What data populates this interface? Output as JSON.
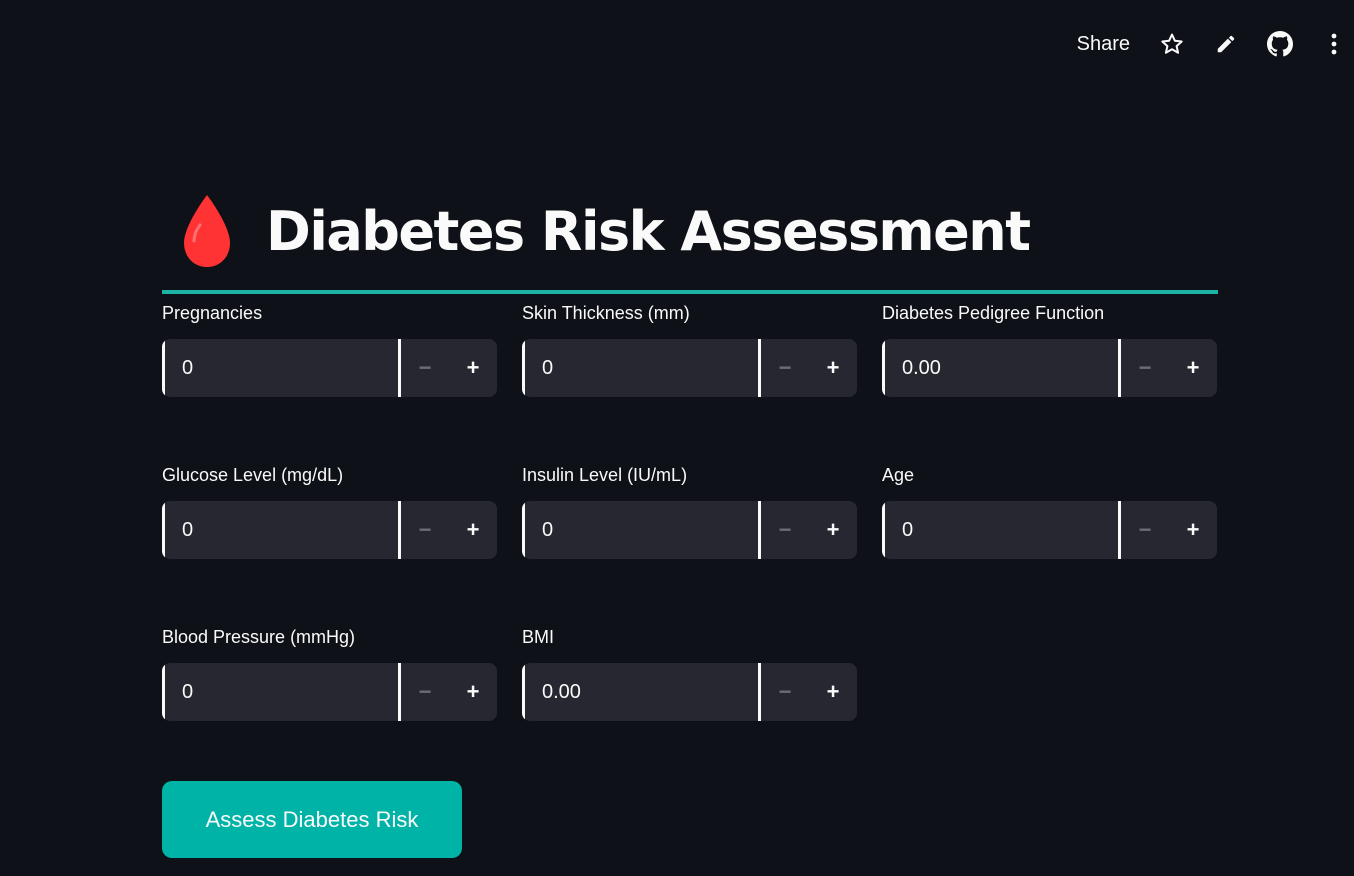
{
  "toolbar": {
    "share_label": "Share",
    "icons": [
      "star-icon",
      "pencil-icon",
      "github-icon",
      "more-vertical-icon"
    ]
  },
  "header": {
    "icon": "blood-drop-icon",
    "icon_color": "#ff3333",
    "title": "Diabetes Risk Assessment",
    "divider_color": "#1db3a5"
  },
  "form": {
    "pregnancies": {
      "label": "Pregnancies",
      "value": "0"
    },
    "glucose": {
      "label": "Glucose Level (mg/dL)",
      "value": "0"
    },
    "blood_pressure": {
      "label": "Blood Pressure (mmHg)",
      "value": "0"
    },
    "skin_thickness": {
      "label": "Skin Thickness (mm)",
      "value": "0"
    },
    "insulin": {
      "label": "Insulin Level (IU/mL)",
      "value": "0"
    },
    "bmi": {
      "label": "BMI",
      "value": "0.00"
    },
    "pedigree": {
      "label": "Diabetes Pedigree Function",
      "value": "0.00"
    },
    "age": {
      "label": "Age",
      "value": "0"
    },
    "minus_symbol": "−",
    "plus_symbol": "+"
  },
  "submit": {
    "label": "Assess Diabetes Risk",
    "color": "#00b3a7"
  }
}
